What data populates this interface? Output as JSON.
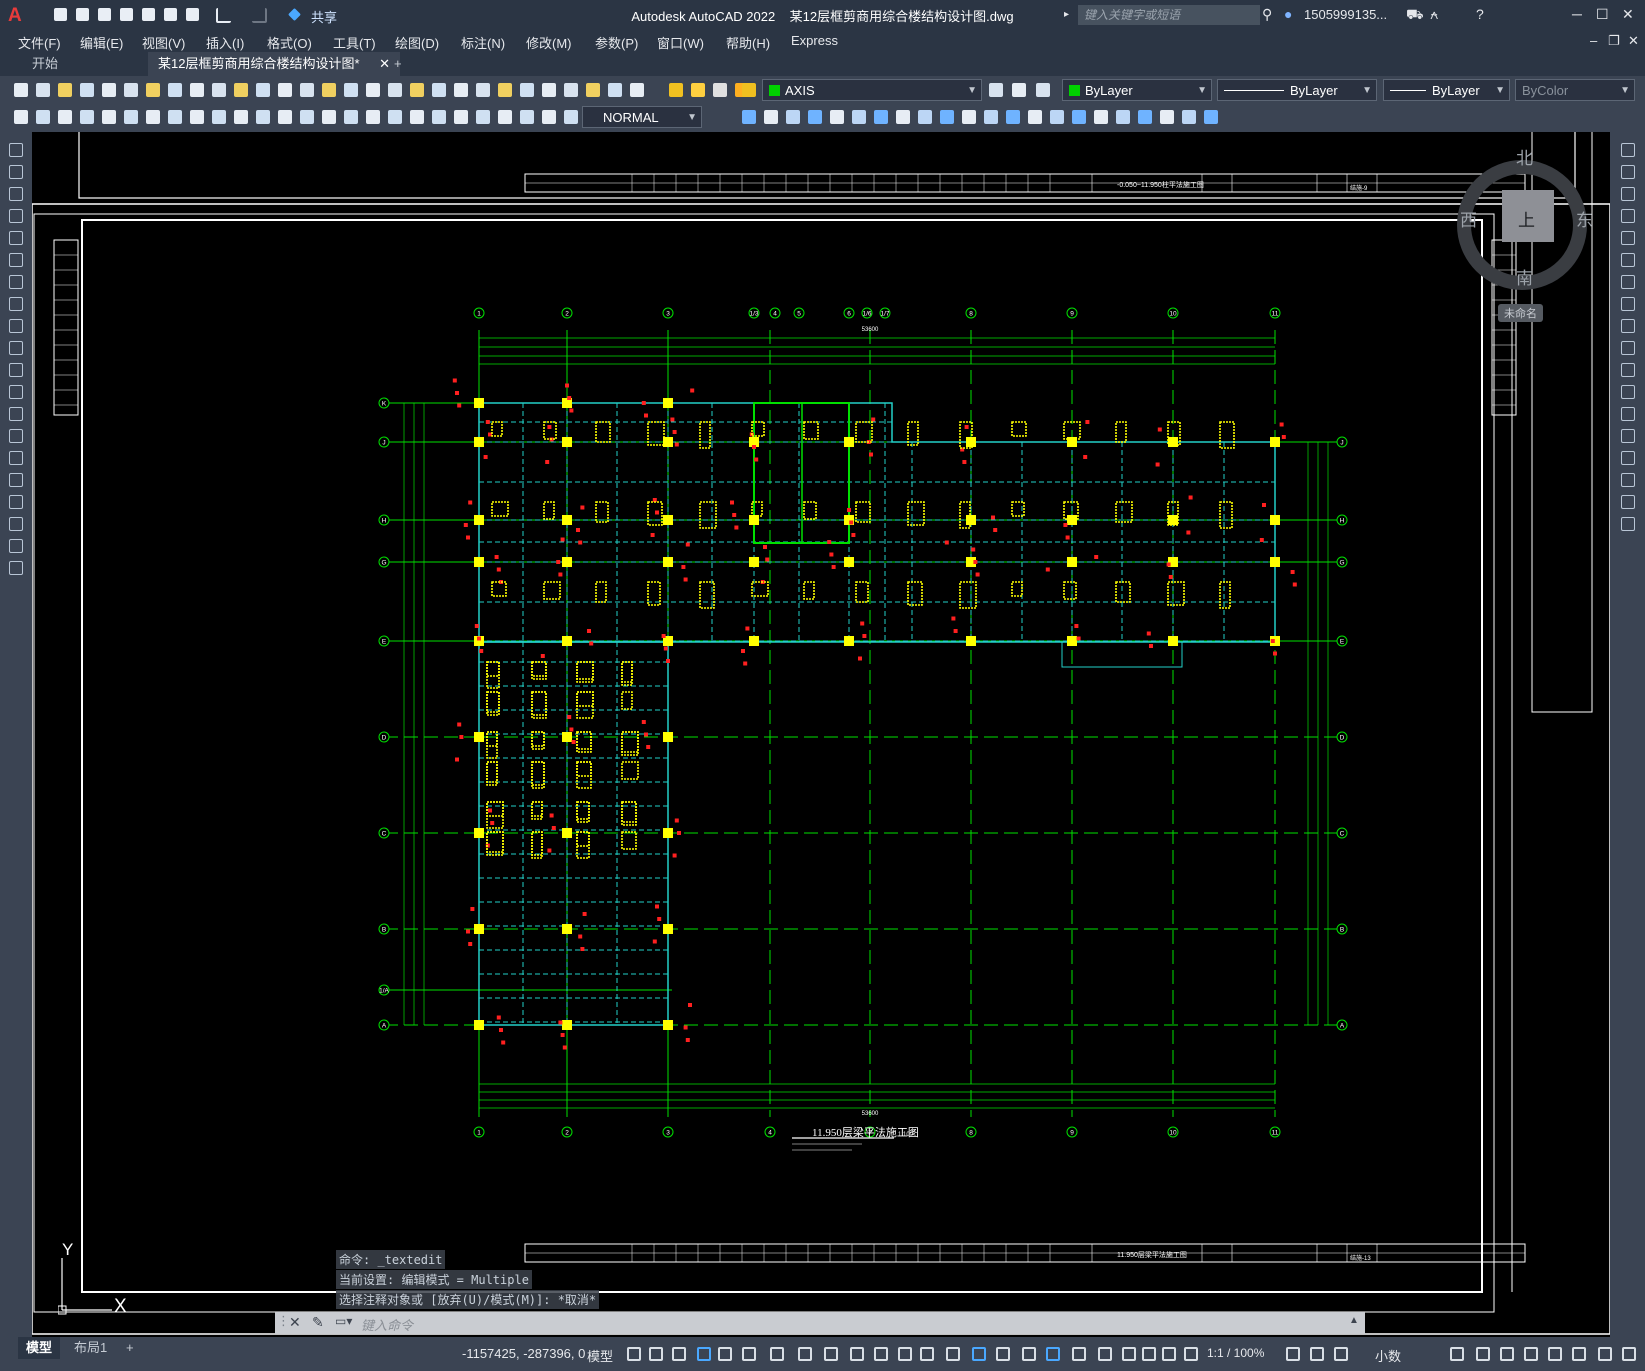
{
  "app": {
    "title": "Autodesk AutoCAD 2022",
    "document_title": "某12层框剪商用综合楼结构设计图.dwg",
    "share_label": "共享",
    "search_placeholder": "键入关键字或短语",
    "user": "1505999135...",
    "logo_letter": "A"
  },
  "menu": [
    "文件(F)",
    "编辑(E)",
    "视图(V)",
    "插入(I)",
    "格式(O)",
    "工具(T)",
    "绘图(D)",
    "标注(N)",
    "修改(M)",
    "参数(P)",
    "窗口(W)",
    "帮助(H)",
    "Express"
  ],
  "tabs": {
    "start": "开始",
    "document": "某12层框剪商用综合楼结构设计图*",
    "close": "✕",
    "add": "+"
  },
  "properties": {
    "layer": "AXIS",
    "color": "ByLayer",
    "linetype": "ByLayer",
    "lineweight": "ByLayer",
    "plotstyle": "ByColor",
    "text_style": "NORMAL",
    "layer_color": "#00d000"
  },
  "viewcube": {
    "north": "北",
    "south": "南",
    "west": "西",
    "east": "东",
    "top": "上",
    "wcs": "未命名"
  },
  "drawing": {
    "title": "11.950层梁平法施工图",
    "scale": "1:100",
    "sheet_title_top": "-0.050~11.950柱平法施工图",
    "sheet_title_bottom": "11.950层梁平法施工图",
    "sheet_no_top": "结施-9",
    "sheet_no_bottom": "结施-13",
    "row_labels_right": [
      "J",
      "H",
      "G",
      "E",
      "D",
      "C",
      "B",
      "A"
    ],
    "row_labels_left": [
      "K",
      "J",
      "H",
      "G",
      "E",
      "D",
      "C",
      "B",
      "1/A",
      "A"
    ],
    "col_labels": [
      "1",
      "2",
      "3",
      "1/3",
      "4",
      "5",
      "6",
      "1/6",
      "1/7",
      "8",
      "9",
      "10",
      "11"
    ],
    "col_labels_bottom": [
      "1",
      "2",
      "3",
      "4",
      "7",
      "8",
      "9",
      "10",
      "11"
    ],
    "total_dim": "53600"
  },
  "axis": {
    "y": "Y",
    "x": "X"
  },
  "command": {
    "history": [
      "命令: _textedit",
      "当前设置: 编辑模式 = Multiple",
      "选择注释对象或 [放弃(U)/模式(M)]: *取消*"
    ],
    "placeholder": "键入命令"
  },
  "status": {
    "model_tab": "模型",
    "layout_tab": "布局1",
    "coords": "-1157425, -287396, 0",
    "model": "模型",
    "scale": "1:1 / 100%",
    "units": "小数"
  }
}
